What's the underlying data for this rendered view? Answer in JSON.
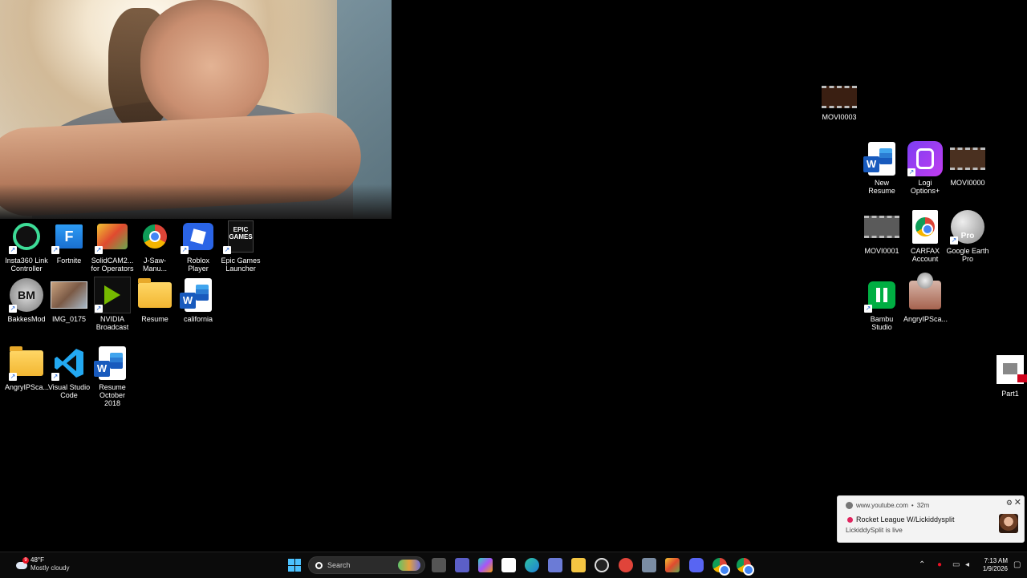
{
  "desktop_icons_left": [
    {
      "label": "Insta360 Link Controller",
      "icon": "insta360-icon"
    },
    {
      "label": "Fortnite",
      "icon": "fortnite-icon"
    },
    {
      "label": "SolidCAM2... for Operators",
      "icon": "solidcam-icon"
    },
    {
      "label": "J-Saw-Manu...",
      "icon": "chrome-icon"
    },
    {
      "label": "Roblox Player",
      "icon": "roblox-icon"
    },
    {
      "label": "Epic Games Launcher",
      "icon": "epic-games-icon",
      "logo_text": "EPIC GAMES"
    },
    {
      "label": "BakkesMod",
      "icon": "bakkesmod-icon",
      "logo_text": "BM"
    },
    {
      "label": "IMG_0175",
      "icon": "photo-icon"
    },
    {
      "label": "NVIDIA Broadcast",
      "icon": "nvidia-broadcast-icon"
    },
    {
      "label": "Resume",
      "icon": "folder-icon"
    },
    {
      "label": "california",
      "icon": "word-doc-icon"
    },
    {
      "label": "AngryIPSca...",
      "icon": "folder-icon"
    },
    {
      "label": "Visual Studio Code",
      "icon": "vscode-icon"
    },
    {
      "label": "Resume October 2018",
      "icon": "word-doc-icon"
    }
  ],
  "desktop_icons_right": [
    {
      "label": "MOVI0003",
      "icon": "video-thumbnail-icon"
    },
    {
      "label": "New Resume",
      "icon": "word-doc-icon"
    },
    {
      "label": "Logi Options+",
      "icon": "logi-options-icon"
    },
    {
      "label": "MOVI0000",
      "icon": "video-thumbnail-icon"
    },
    {
      "label": "MOVI0001",
      "icon": "video-thumbnail-icon"
    },
    {
      "label": "CARFAX Account",
      "icon": "chrome-doc-icon"
    },
    {
      "label": "Google Earth Pro",
      "icon": "google-earth-icon",
      "logo_text": "Pro"
    },
    {
      "label": "Bambu Studio",
      "icon": "bambu-studio-icon"
    },
    {
      "label": "AngryIPSca...",
      "icon": "angryip-icon"
    },
    {
      "label": "Part1",
      "icon": "solidworks-part-icon"
    }
  ],
  "notification": {
    "source": "www.youtube.com",
    "separator": "•",
    "age": "32m",
    "title": "Rocket League W/Lickiddysplit",
    "body": "LickiddySplit is live",
    "settings_glyph": "⚙",
    "close_glyph": "✕"
  },
  "taskbar": {
    "weather_temp": "48°F",
    "weather_desc": "Mostly cloudy",
    "weather_badge": "9",
    "search_placeholder": "Search",
    "time": "7:13 AM",
    "date": "1/9/2026",
    "pinned": [
      "task-view-icon",
      "zoom-icon",
      "copilot-icon",
      "store-icon",
      "edge-icon",
      "game-controller-icon",
      "file-explorer-icon",
      "obs-icon",
      "red-app-icon",
      "settings-icon",
      "solidworks-icon",
      "discord-icon",
      "chrome-icon",
      "chrome-alt-icon"
    ]
  },
  "colors": {
    "desktop_bg": "#000000",
    "taskbar_bg": "#0b0b0b",
    "start_blue": "#4cc2ff",
    "notification_bg": "#f3f3f3"
  }
}
